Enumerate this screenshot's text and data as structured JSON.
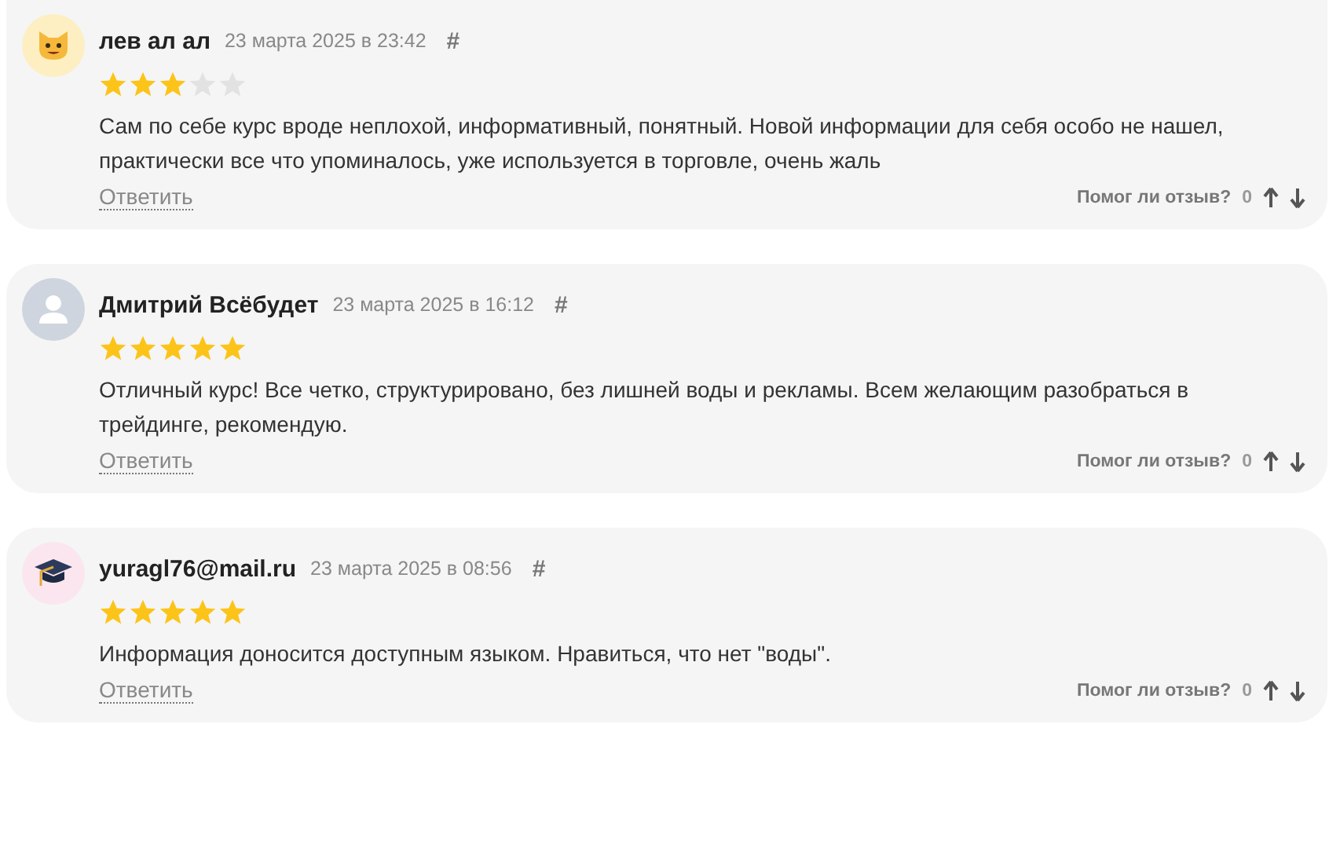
{
  "reviews": [
    {
      "kind": "cat",
      "author": "лев ал ал",
      "date": "23 марта 2025 в 23:42",
      "anchor": "#",
      "stars": 3,
      "text": "Сам по себе курс вроде неплохой, информативный, понятный. Новой информации для себя особо не нашел, практически все что упоминалось, уже используется в торговле, очень жаль",
      "reply": "Ответить",
      "helpful_label": "Помог ли отзыв?",
      "helpful_count": "0"
    },
    {
      "kind": "default",
      "author": "Дмитрий Всёбудет",
      "date": "23 марта 2025 в 16:12",
      "anchor": "#",
      "stars": 5,
      "text": "Отличный курс! Все четко, структурировано, без лишней воды и рекламы. Всем желающим разобраться в трейдинге, рекомендую.",
      "reply": "Ответить",
      "helpful_label": "Помог ли отзыв?",
      "helpful_count": "0"
    },
    {
      "kind": "cap",
      "author": "yuragl76@mail.ru",
      "date": "23 марта 2025 в 08:56",
      "anchor": "#",
      "stars": 5,
      "text": "Информация доносится доступным языком. Нравиться, что нет \"воды\".",
      "reply": "Ответить",
      "helpful_label": "Помог ли отзыв?",
      "helpful_count": "0"
    }
  ]
}
